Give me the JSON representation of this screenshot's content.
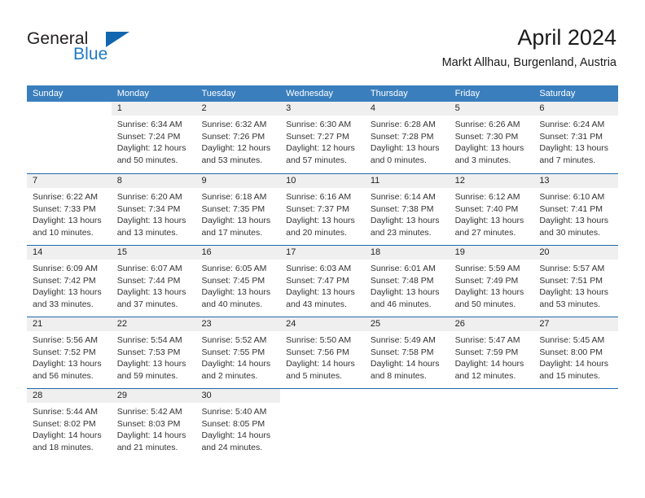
{
  "logo": {
    "word_one": "General",
    "word_two": "Blue",
    "triangle_color": "#1166ae"
  },
  "header": {
    "title": "April 2024",
    "subtitle": "Markt Allhau, Burgenland, Austria"
  },
  "theme": {
    "header_blue": "#3a7ebd",
    "row_divider_blue": "#1f69ad",
    "day_band_gray": "#efefef"
  },
  "weekdays": [
    "Sunday",
    "Monday",
    "Tuesday",
    "Wednesday",
    "Thursday",
    "Friday",
    "Saturday"
  ],
  "weeks": [
    [
      {
        "day": "",
        "lines": []
      },
      {
        "day": "1",
        "lines": [
          "Sunrise: 6:34 AM",
          "Sunset: 7:24 PM",
          "Daylight: 12 hours",
          "and 50 minutes."
        ]
      },
      {
        "day": "2",
        "lines": [
          "Sunrise: 6:32 AM",
          "Sunset: 7:26 PM",
          "Daylight: 12 hours",
          "and 53 minutes."
        ]
      },
      {
        "day": "3",
        "lines": [
          "Sunrise: 6:30 AM",
          "Sunset: 7:27 PM",
          "Daylight: 12 hours",
          "and 57 minutes."
        ]
      },
      {
        "day": "4",
        "lines": [
          "Sunrise: 6:28 AM",
          "Sunset: 7:28 PM",
          "Daylight: 13 hours",
          "and 0 minutes."
        ]
      },
      {
        "day": "5",
        "lines": [
          "Sunrise: 6:26 AM",
          "Sunset: 7:30 PM",
          "Daylight: 13 hours",
          "and 3 minutes."
        ]
      },
      {
        "day": "6",
        "lines": [
          "Sunrise: 6:24 AM",
          "Sunset: 7:31 PM",
          "Daylight: 13 hours",
          "and 7 minutes."
        ]
      }
    ],
    [
      {
        "day": "7",
        "lines": [
          "Sunrise: 6:22 AM",
          "Sunset: 7:33 PM",
          "Daylight: 13 hours",
          "and 10 minutes."
        ]
      },
      {
        "day": "8",
        "lines": [
          "Sunrise: 6:20 AM",
          "Sunset: 7:34 PM",
          "Daylight: 13 hours",
          "and 13 minutes."
        ]
      },
      {
        "day": "9",
        "lines": [
          "Sunrise: 6:18 AM",
          "Sunset: 7:35 PM",
          "Daylight: 13 hours",
          "and 17 minutes."
        ]
      },
      {
        "day": "10",
        "lines": [
          "Sunrise: 6:16 AM",
          "Sunset: 7:37 PM",
          "Daylight: 13 hours",
          "and 20 minutes."
        ]
      },
      {
        "day": "11",
        "lines": [
          "Sunrise: 6:14 AM",
          "Sunset: 7:38 PM",
          "Daylight: 13 hours",
          "and 23 minutes."
        ]
      },
      {
        "day": "12",
        "lines": [
          "Sunrise: 6:12 AM",
          "Sunset: 7:40 PM",
          "Daylight: 13 hours",
          "and 27 minutes."
        ]
      },
      {
        "day": "13",
        "lines": [
          "Sunrise: 6:10 AM",
          "Sunset: 7:41 PM",
          "Daylight: 13 hours",
          "and 30 minutes."
        ]
      }
    ],
    [
      {
        "day": "14",
        "lines": [
          "Sunrise: 6:09 AM",
          "Sunset: 7:42 PM",
          "Daylight: 13 hours",
          "and 33 minutes."
        ]
      },
      {
        "day": "15",
        "lines": [
          "Sunrise: 6:07 AM",
          "Sunset: 7:44 PM",
          "Daylight: 13 hours",
          "and 37 minutes."
        ]
      },
      {
        "day": "16",
        "lines": [
          "Sunrise: 6:05 AM",
          "Sunset: 7:45 PM",
          "Daylight: 13 hours",
          "and 40 minutes."
        ]
      },
      {
        "day": "17",
        "lines": [
          "Sunrise: 6:03 AM",
          "Sunset: 7:47 PM",
          "Daylight: 13 hours",
          "and 43 minutes."
        ]
      },
      {
        "day": "18",
        "lines": [
          "Sunrise: 6:01 AM",
          "Sunset: 7:48 PM",
          "Daylight: 13 hours",
          "and 46 minutes."
        ]
      },
      {
        "day": "19",
        "lines": [
          "Sunrise: 5:59 AM",
          "Sunset: 7:49 PM",
          "Daylight: 13 hours",
          "and 50 minutes."
        ]
      },
      {
        "day": "20",
        "lines": [
          "Sunrise: 5:57 AM",
          "Sunset: 7:51 PM",
          "Daylight: 13 hours",
          "and 53 minutes."
        ]
      }
    ],
    [
      {
        "day": "21",
        "lines": [
          "Sunrise: 5:56 AM",
          "Sunset: 7:52 PM",
          "Daylight: 13 hours",
          "and 56 minutes."
        ]
      },
      {
        "day": "22",
        "lines": [
          "Sunrise: 5:54 AM",
          "Sunset: 7:53 PM",
          "Daylight: 13 hours",
          "and 59 minutes."
        ]
      },
      {
        "day": "23",
        "lines": [
          "Sunrise: 5:52 AM",
          "Sunset: 7:55 PM",
          "Daylight: 14 hours",
          "and 2 minutes."
        ]
      },
      {
        "day": "24",
        "lines": [
          "Sunrise: 5:50 AM",
          "Sunset: 7:56 PM",
          "Daylight: 14 hours",
          "and 5 minutes."
        ]
      },
      {
        "day": "25",
        "lines": [
          "Sunrise: 5:49 AM",
          "Sunset: 7:58 PM",
          "Daylight: 14 hours",
          "and 8 minutes."
        ]
      },
      {
        "day": "26",
        "lines": [
          "Sunrise: 5:47 AM",
          "Sunset: 7:59 PM",
          "Daylight: 14 hours",
          "and 12 minutes."
        ]
      },
      {
        "day": "27",
        "lines": [
          "Sunrise: 5:45 AM",
          "Sunset: 8:00 PM",
          "Daylight: 14 hours",
          "and 15 minutes."
        ]
      }
    ],
    [
      {
        "day": "28",
        "lines": [
          "Sunrise: 5:44 AM",
          "Sunset: 8:02 PM",
          "Daylight: 14 hours",
          "and 18 minutes."
        ]
      },
      {
        "day": "29",
        "lines": [
          "Sunrise: 5:42 AM",
          "Sunset: 8:03 PM",
          "Daylight: 14 hours",
          "and 21 minutes."
        ]
      },
      {
        "day": "30",
        "lines": [
          "Sunrise: 5:40 AM",
          "Sunset: 8:05 PM",
          "Daylight: 14 hours",
          "and 24 minutes."
        ]
      },
      {
        "day": "",
        "lines": []
      },
      {
        "day": "",
        "lines": []
      },
      {
        "day": "",
        "lines": []
      },
      {
        "day": "",
        "lines": []
      }
    ]
  ]
}
